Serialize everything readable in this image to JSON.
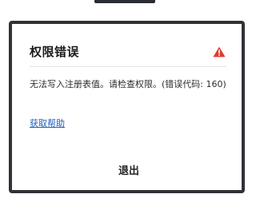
{
  "dialog": {
    "title": "权限错误",
    "icon": "warning-icon",
    "message": "无法写入注册表值。请检查权限。(错误代码: 160)",
    "help_link": "获取帮助",
    "exit_button": "退出"
  },
  "colors": {
    "warning": "#e23b2e",
    "link": "#1f5fbf",
    "dialog_border": "#2f3237"
  }
}
